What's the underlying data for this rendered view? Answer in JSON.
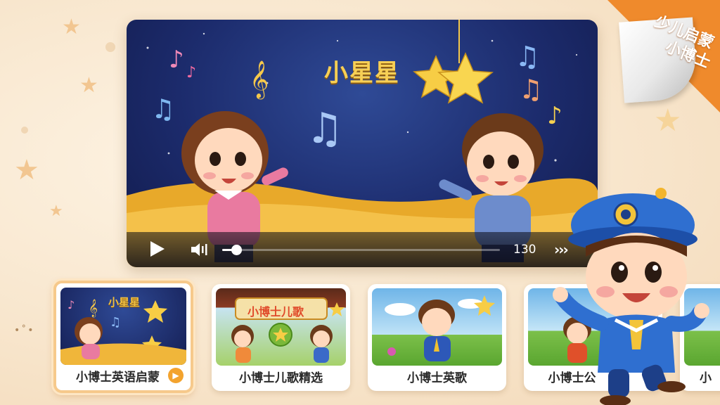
{
  "player": {
    "title": "小星星",
    "time": "130",
    "progress": 0.05,
    "controls": {
      "play_icon": "play-icon",
      "volume_icon": "volume-icon",
      "next_icon": "next-icon"
    }
  },
  "corner_badge": {
    "line1": "少儿启蒙",
    "line2": "小博士",
    "color": "#ef8a2c"
  },
  "cards": [
    {
      "label": "小博士英语启蒙",
      "thumb_title": "小星星",
      "selected": true
    },
    {
      "label": "小博士儿歌精选",
      "thumb_title": "小博士儿歌",
      "selected": false
    },
    {
      "label": "小博士英歌",
      "thumb_title": "",
      "selected": false
    },
    {
      "label": "小博士公",
      "thumb_title": "",
      "selected": false
    },
    {
      "label": "小",
      "thumb_title": "",
      "selected": false
    }
  ],
  "colors": {
    "accent": "#f3a32e",
    "title_gold": "#f7cf55",
    "video_bg": "#1c2b6c"
  }
}
